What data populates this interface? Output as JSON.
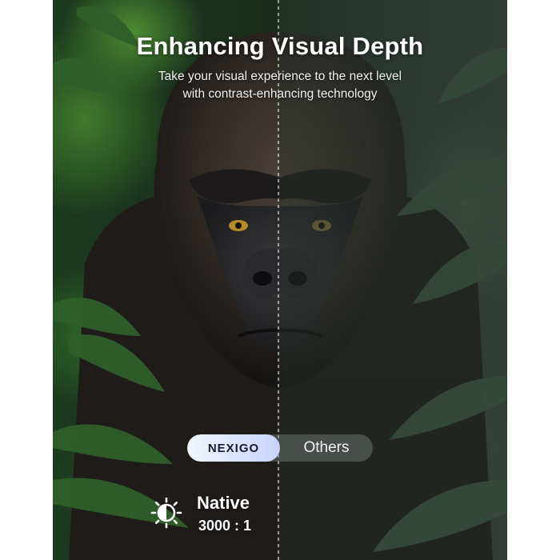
{
  "headline": {
    "title": "Enhancing Visual Depth",
    "subtitle_line1": "Take your visual experience to the next level",
    "subtitle_line2": "with contrast-enhancing technology"
  },
  "comparison": {
    "brand_label": "NEXIGO",
    "other_label": "Others"
  },
  "spec": {
    "icon": "contrast-icon",
    "label": "Native",
    "value": "3000 : 1"
  },
  "colors": {
    "foliage_green": "#2f6b2c",
    "toggle_highlight": "#c6d4ff",
    "text": "#ffffff"
  }
}
